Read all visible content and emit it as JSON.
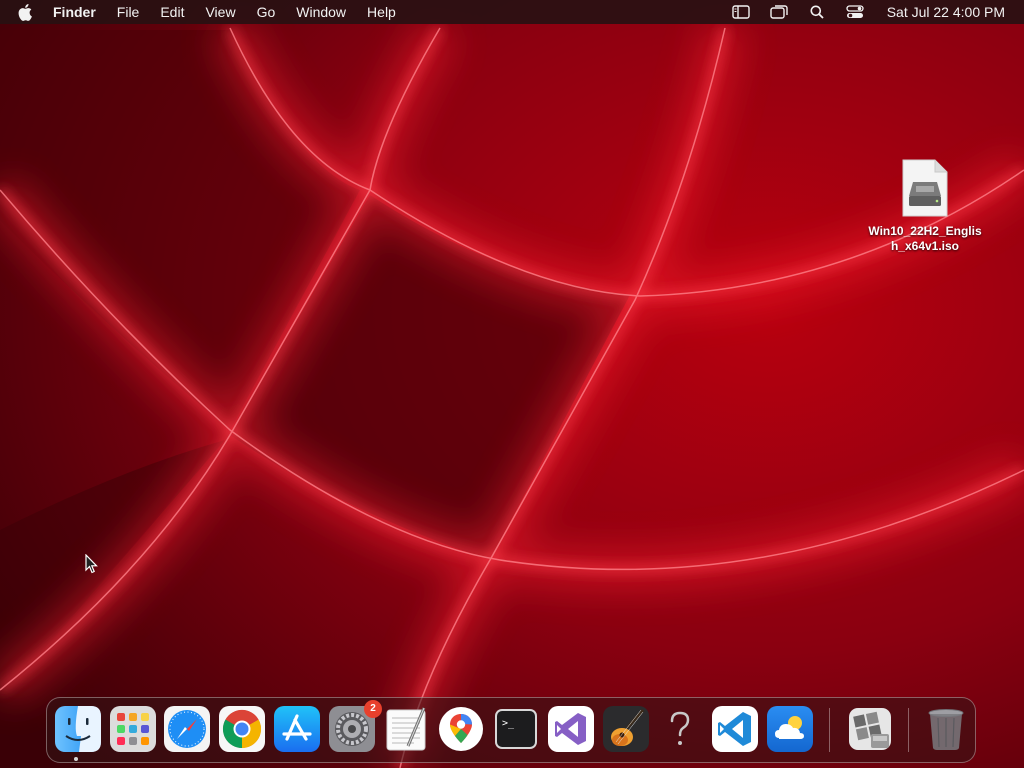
{
  "menubar": {
    "app_name": "Finder",
    "items": [
      "File",
      "Edit",
      "View",
      "Go",
      "Window",
      "Help"
    ],
    "clock": "Sat Jul 22  4:00 PM",
    "status_icons": [
      "reading-list-icon",
      "screen-mirroring-icon",
      "spotlight-search-icon",
      "control-center-icon"
    ]
  },
  "desktop": {
    "file": {
      "name": "Win10_22H2_English_x64v1.iso",
      "icon": "disk-image-icon"
    }
  },
  "dock": {
    "apps": [
      {
        "name": "Finder",
        "icon": "finder-icon",
        "running": true
      },
      {
        "name": "Launchpad",
        "icon": "launchpad-icon"
      },
      {
        "name": "Safari",
        "icon": "safari-icon"
      },
      {
        "name": "Google Chrome",
        "icon": "chrome-icon"
      },
      {
        "name": "App Store",
        "icon": "app-store-icon"
      },
      {
        "name": "System Settings",
        "icon": "system-settings-icon",
        "badge": "2"
      },
      {
        "name": "TextEdit",
        "icon": "textedit-icon"
      },
      {
        "name": "Google Maps",
        "icon": "google-maps-icon"
      },
      {
        "name": "Terminal",
        "icon": "terminal-icon"
      },
      {
        "name": "Visual Studio",
        "icon": "visual-studio-icon"
      },
      {
        "name": "GarageBand",
        "icon": "garageband-icon"
      },
      {
        "name": "Help",
        "icon": "question-mark-icon"
      },
      {
        "name": "Visual Studio Code",
        "icon": "vscode-icon"
      },
      {
        "name": "Weather",
        "icon": "weather-icon"
      },
      {
        "name": "Boot Camp Assistant",
        "icon": "boot-camp-icon"
      },
      {
        "name": "Trash",
        "icon": "trash-icon"
      }
    ],
    "terminal_prompt": ">_"
  },
  "colors": {
    "wallpaper_base": "#5a0008",
    "wallpaper_glow": "#ff2a3a",
    "badge": "#e8402d"
  }
}
